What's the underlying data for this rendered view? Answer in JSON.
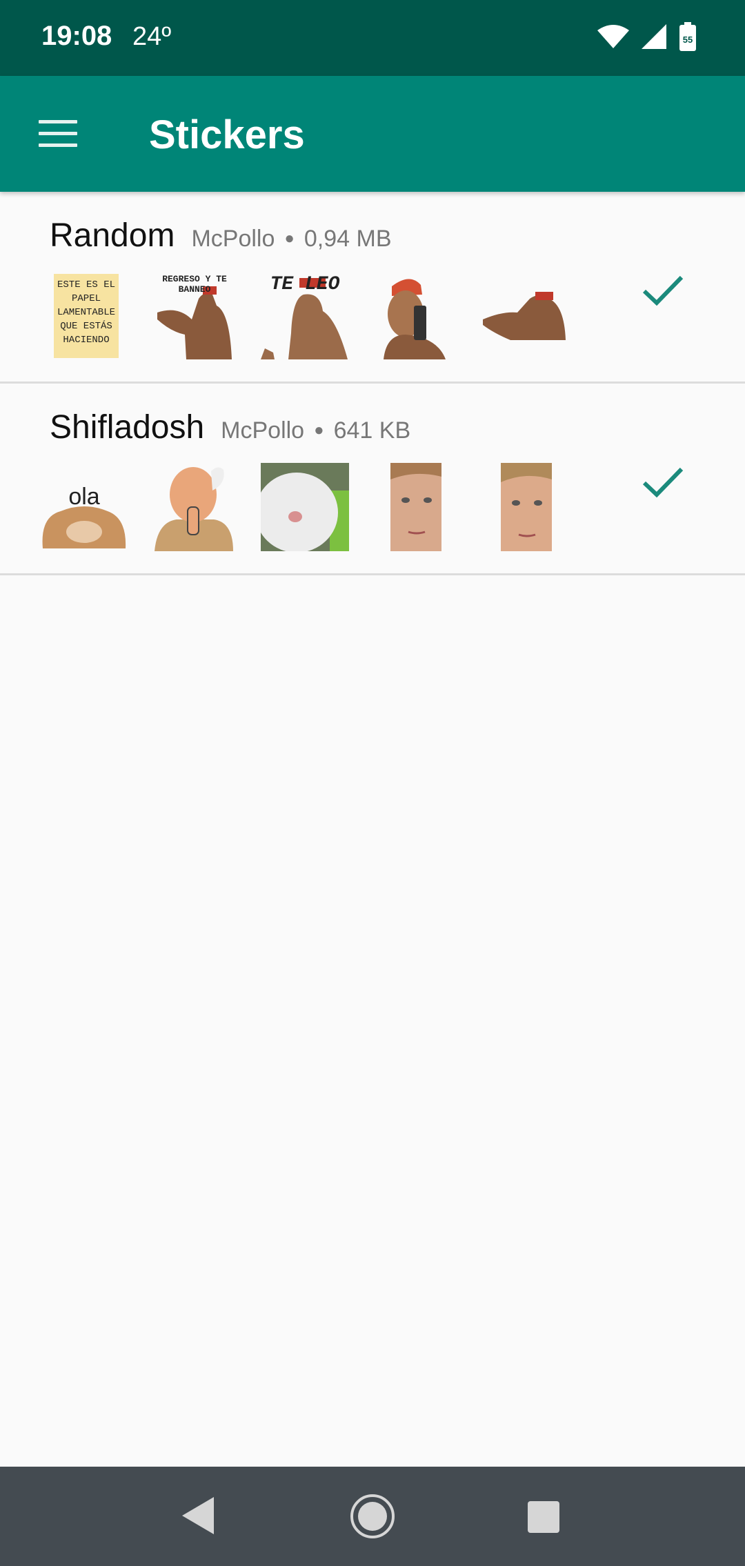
{
  "status_bar": {
    "time": "19:08",
    "temperature": "24º",
    "icons": [
      "wifi-icon",
      "cellular-signal-icon",
      "battery-icon"
    ],
    "battery_level": "55"
  },
  "app_bar": {
    "title": "Stickers",
    "menu_icon": "hamburger-menu-icon",
    "color": "#008577",
    "status_color": "#00574b"
  },
  "packs": [
    {
      "name": "Random",
      "publisher": "McPollo",
      "size": "0,94 MB",
      "added_icon": "check-icon",
      "stickers": [
        {
          "kind": "note",
          "text": "ESTE ES EL PAPEL LAMENTABLE QUE ESTÁS HACIENDO"
        },
        {
          "kind": "man",
          "text": "REGRESO Y TE BANNEO"
        },
        {
          "kind": "man",
          "text": "TE LEO"
        },
        {
          "kind": "man-gun",
          "text": ""
        },
        {
          "kind": "man-reach",
          "text": ""
        }
      ]
    },
    {
      "name": "Shifladosh",
      "publisher": "McPollo",
      "size": "641 KB",
      "added_icon": "check-icon",
      "stickers": [
        {
          "kind": "cat-ola",
          "text": "ola"
        },
        {
          "kind": "cartoon-old-man",
          "text": ""
        },
        {
          "kind": "cat-closeup",
          "text": ""
        },
        {
          "kind": "face",
          "text": ""
        },
        {
          "kind": "face",
          "text": ""
        }
      ]
    }
  ],
  "nav_bar": {
    "icons": [
      "back-icon",
      "home-icon",
      "recents-icon"
    ]
  },
  "colors": {
    "accent": "#008577",
    "check": "#1b8a7c",
    "background": "#fafafa"
  }
}
